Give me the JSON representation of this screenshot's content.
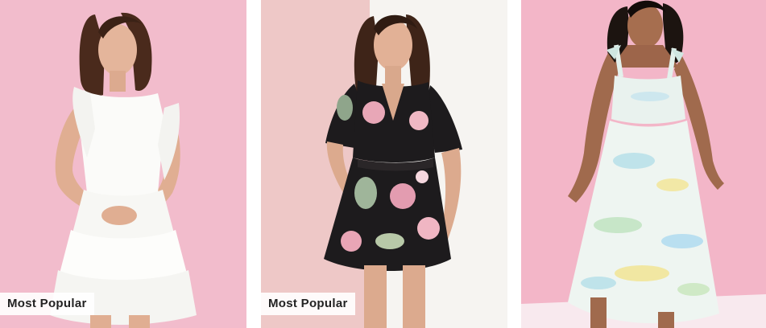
{
  "products": [
    {
      "image": "model-white-ruffle-tiered-mini-dress-photo",
      "badge": "Most Popular",
      "background_color": "#f1b8c9",
      "dress_color": "#fbfbf9"
    },
    {
      "image": "model-black-floral-wrap-dress-photo",
      "badge": "Most Popular",
      "background_color": "#eec8c7",
      "dress_color": "#1d1b1d"
    },
    {
      "image": "model-pastel-watercolor-midi-dress-photo",
      "badge": "",
      "background_color": "#f3b6c8",
      "dress_color": "#e9f2ee"
    }
  ]
}
